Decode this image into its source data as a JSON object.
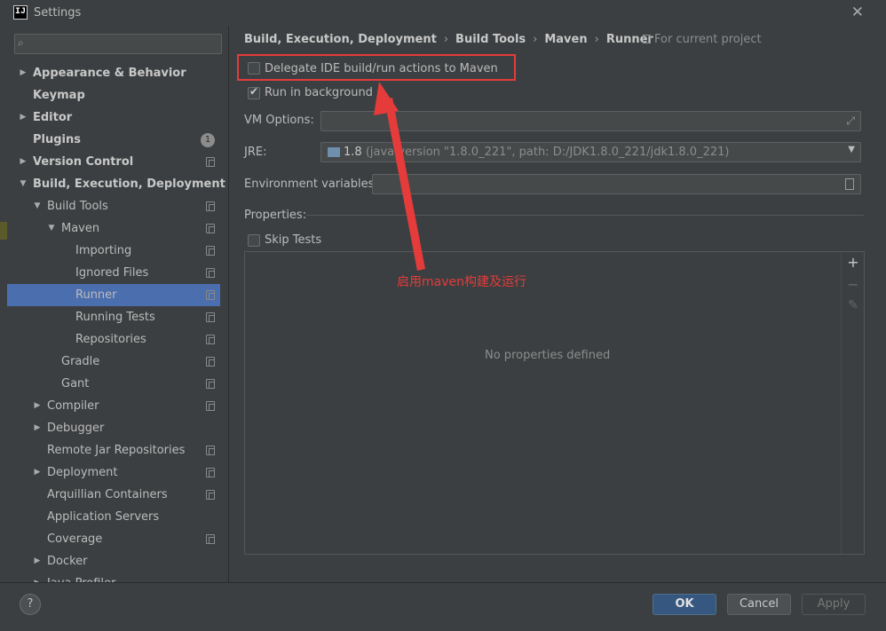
{
  "window": {
    "title": "Settings",
    "app_icon": "IJ",
    "close_icon": "close-icon"
  },
  "sidebar": {
    "search_placeholder": "",
    "items": [
      {
        "label": "Appearance & Behavior",
        "level": 0,
        "arrow": "▶",
        "bold": true
      },
      {
        "label": "Keymap",
        "level": 0,
        "arrow": "",
        "bold": true
      },
      {
        "label": "Editor",
        "level": 0,
        "arrow": "▶",
        "bold": true
      },
      {
        "label": "Plugins",
        "level": 0,
        "arrow": "",
        "bold": true,
        "badge": "1"
      },
      {
        "label": "Version Control",
        "level": 0,
        "arrow": "▶",
        "bold": true,
        "copy": true
      },
      {
        "label": "Build, Execution, Deployment",
        "level": 0,
        "arrow": "▼",
        "bold": true
      },
      {
        "label": "Build Tools",
        "level": 1,
        "arrow": "▼",
        "copy": true
      },
      {
        "label": "Maven",
        "level": 2,
        "arrow": "▼",
        "copy": true
      },
      {
        "label": "Importing",
        "level": 3,
        "arrow": "",
        "copy": true
      },
      {
        "label": "Ignored Files",
        "level": 3,
        "arrow": "",
        "copy": true
      },
      {
        "label": "Runner",
        "level": 3,
        "arrow": "",
        "copy": true,
        "selected": true
      },
      {
        "label": "Running Tests",
        "level": 3,
        "arrow": "",
        "copy": true
      },
      {
        "label": "Repositories",
        "level": 3,
        "arrow": "",
        "copy": true
      },
      {
        "label": "Gradle",
        "level": 2,
        "arrow": "",
        "copy": true
      },
      {
        "label": "Gant",
        "level": 2,
        "arrow": "",
        "copy": true
      },
      {
        "label": "Compiler",
        "level": 1,
        "arrow": "▶",
        "copy": true
      },
      {
        "label": "Debugger",
        "level": 1,
        "arrow": "▶"
      },
      {
        "label": "Remote Jar Repositories",
        "level": 1,
        "arrow": "",
        "copy": true
      },
      {
        "label": "Deployment",
        "level": 1,
        "arrow": "▶",
        "copy": true
      },
      {
        "label": "Arquillian Containers",
        "level": 1,
        "arrow": "",
        "copy": true
      },
      {
        "label": "Application Servers",
        "level": 1,
        "arrow": ""
      },
      {
        "label": "Coverage",
        "level": 1,
        "arrow": "",
        "copy": true
      },
      {
        "label": "Docker",
        "level": 1,
        "arrow": "▶"
      },
      {
        "label": "Java Profiler",
        "level": 1,
        "arrow": "▶"
      }
    ]
  },
  "breadcrumb": {
    "parts": [
      "Build, Execution, Deployment",
      "Build Tools",
      "Maven",
      "Runner"
    ],
    "scope": "For current project"
  },
  "runner": {
    "delegate_label": "Delegate IDE build/run actions to Maven",
    "delegate_checked": false,
    "background_label": "Run in background",
    "background_checked": true,
    "vm_options_label": "VM Options:",
    "vm_options_value": "",
    "jre_label": "JRE:",
    "jre_version": "1.8",
    "jre_detail": "(java version \"1.8.0_221\", path: D:/JDK1.8.0_221/jdk1.8.0_221)",
    "env_label": "Environment variables:",
    "env_value": "",
    "properties_label": "Properties:",
    "skip_tests_label": "Skip Tests",
    "skip_tests_checked": false,
    "empty_message": "No properties defined",
    "toolbar": {
      "add": "+",
      "remove": "−",
      "edit": "✎"
    }
  },
  "annotation": {
    "text": "启用maven构建及运行",
    "color": "#e53b3b"
  },
  "footer": {
    "help": "?",
    "ok": "OK",
    "cancel": "Cancel",
    "apply": "Apply"
  }
}
